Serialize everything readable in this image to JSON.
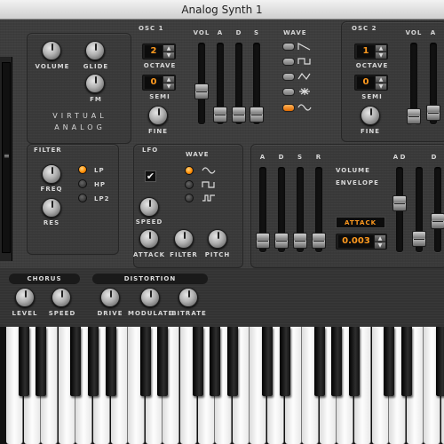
{
  "window": {
    "title": "Analog Synth 1"
  },
  "brand": {
    "line1": "VIRTUAL",
    "line2": "ANALOG"
  },
  "master": {
    "volume": "VOLUME",
    "glide": "GLIDE",
    "fm": "FM"
  },
  "osc1": {
    "title": "OSC 1",
    "octave_value": "2",
    "octave_label": "OCTAVE",
    "semi_value": "0",
    "semi_label": "SEMI",
    "fine_label": "FINE"
  },
  "osc1_faders": {
    "vol": "VOL",
    "a": "A",
    "d": "D",
    "s": "S"
  },
  "osc1_wave": {
    "title": "WAVE",
    "selected_index": 4
  },
  "osc2": {
    "title": "OSC 2",
    "octave_value": "1",
    "octave_label": "OCTAVE",
    "semi_value": "0",
    "semi_label": "SEMI",
    "fine_label": "FINE",
    "vol": "VOL",
    "a": "A"
  },
  "filter": {
    "title": "FILTER",
    "freq": "FREQ",
    "res": "RES",
    "modes": [
      "LP",
      "HP",
      "LP2"
    ],
    "selected_index": 0
  },
  "lfo": {
    "title": "LFO",
    "wave_title": "WAVE",
    "selected_index": 0,
    "speed": "SPEED",
    "attack": "ATTACK",
    "filter": "FILTER",
    "pitch": "PITCH",
    "enabled": true,
    "check_glyph": "✔"
  },
  "envelope": {
    "a": "A",
    "d": "D",
    "s": "S",
    "r": "R",
    "volume_label": "VOLUME",
    "envelope_label": "ENVELOPE",
    "param_label": "ATTACK",
    "param_value": "0.003",
    "ad_a": "A",
    "ad_d": "D",
    "ad_partial": "D"
  },
  "chorus": {
    "title": "CHORUS",
    "level": "LEVEL",
    "speed": "SPEED"
  },
  "distortion": {
    "title": "DISTORTION",
    "drive": "DRIVE",
    "modulate": "MODULATE",
    "bitrate": "BITRATE"
  },
  "colors": {
    "accent": "#ff8a00",
    "panel": "#3d3d3d",
    "lcd_text": "#ff9a1f"
  },
  "icons": {
    "scroll_grip": "≡",
    "stepper_up": "▲",
    "stepper_down": "▼"
  }
}
